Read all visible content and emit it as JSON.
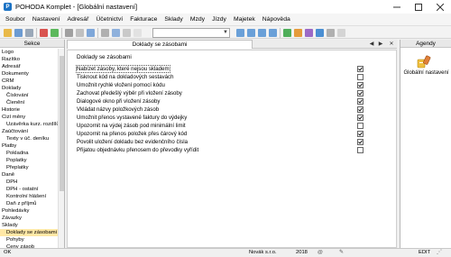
{
  "window": {
    "title": "POHODA Komplet - [Globální nastavení]",
    "minimize_icon": "minimize-icon",
    "maximize_icon": "maximize-icon",
    "close_icon": "close-icon"
  },
  "menu": {
    "items": [
      "Soubor",
      "Nastavení",
      "Adresář",
      "Účetnictví",
      "Fakturace",
      "Sklady",
      "Mzdy",
      "Jízdy",
      "Majetek",
      "Nápověda"
    ]
  },
  "sekce": {
    "header": "Sekce",
    "items": [
      {
        "label": "Logo",
        "level": 0,
        "selected": false
      },
      {
        "label": "Razítko",
        "level": 0,
        "selected": false
      },
      {
        "label": "Adresář",
        "level": 0,
        "selected": false
      },
      {
        "label": "Dokumenty",
        "level": 0,
        "selected": false
      },
      {
        "label": "CRM",
        "level": 0,
        "selected": false
      },
      {
        "label": "Doklady",
        "level": 0,
        "selected": false
      },
      {
        "label": "Číslování",
        "level": 1,
        "selected": false
      },
      {
        "label": "Členění",
        "level": 1,
        "selected": false
      },
      {
        "label": "Historie",
        "level": 0,
        "selected": false
      },
      {
        "label": "Cizí měny",
        "level": 0,
        "selected": false
      },
      {
        "label": "Uzávěrka kurz. rozdílů",
        "level": 1,
        "selected": false
      },
      {
        "label": "Zaúčtování",
        "level": 0,
        "selected": false
      },
      {
        "label": "Texty v úč. deníku",
        "level": 1,
        "selected": false
      },
      {
        "label": "Platby",
        "level": 0,
        "selected": false
      },
      {
        "label": "Pokladna",
        "level": 1,
        "selected": false
      },
      {
        "label": "Poplatky",
        "level": 1,
        "selected": false
      },
      {
        "label": "Přeplatky",
        "level": 1,
        "selected": false
      },
      {
        "label": "Daně",
        "level": 0,
        "selected": false
      },
      {
        "label": "DPH",
        "level": 1,
        "selected": false
      },
      {
        "label": "DPH - ostatní",
        "level": 1,
        "selected": false
      },
      {
        "label": "Kontrolní hlášení",
        "level": 1,
        "selected": false
      },
      {
        "label": "Daň z příjmů",
        "level": 1,
        "selected": false
      },
      {
        "label": "Pohledávky",
        "level": 0,
        "selected": false
      },
      {
        "label": "Závazky",
        "level": 0,
        "selected": false
      },
      {
        "label": "Sklady",
        "level": 0,
        "selected": false
      },
      {
        "label": "Doklady se zásobami",
        "level": 1,
        "selected": true
      },
      {
        "label": "Pohyby",
        "level": 1,
        "selected": false
      },
      {
        "label": "Ceny zásob",
        "level": 1,
        "selected": false
      }
    ]
  },
  "main": {
    "tab_label": "Doklady se zásobami",
    "tab_prev_icon": "chevron-left-icon",
    "tab_next_icon": "chevron-right-icon",
    "tab_close_icon": "close-icon",
    "group_title": "Doklady se zásobami",
    "options": [
      {
        "label": "Nabízet zásoby, které nejsou skladem",
        "checked": true
      },
      {
        "label": "Tisknout kód na dokladových sestavách",
        "checked": false
      },
      {
        "label": "Umožnit rychlé vložení pomocí kódu",
        "checked": true
      },
      {
        "label": "Zachovat předešlý výběr při vložení zásoby",
        "checked": true
      },
      {
        "label": "Dialogové okno při vložení zásoby",
        "checked": true
      },
      {
        "label": "Vkládat názvy položkových zásob",
        "checked": true
      },
      {
        "label": "Umožnit přenos vystavené faktury do výdejky",
        "checked": true
      },
      {
        "label": "Upozornit na výdej zásob pod minimální limit",
        "checked": false
      },
      {
        "label": "Upozornit na přenos položek přes čárový kód",
        "checked": true
      },
      {
        "label": "Povolit uložení dokladu bez evidenčního čísla",
        "checked": true
      },
      {
        "label": "Přijatou objednávku přenosem do převodky vyřídit",
        "checked": false
      }
    ]
  },
  "agendy": {
    "header": "Agendy",
    "item_label": "Globální nastavení",
    "item_icon": "settings-brush-icon"
  },
  "status": {
    "mode": "OK",
    "company": "Novák s.r.o.",
    "year": "2018",
    "edit": "EDIT"
  },
  "colors": {
    "selected_row": "#ffe8a6",
    "accent": "#1b72c4"
  }
}
